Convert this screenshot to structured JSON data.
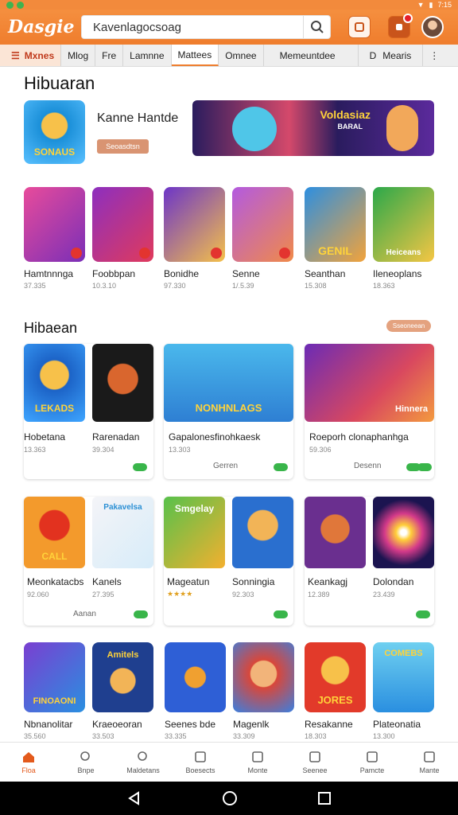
{
  "status": {
    "time": "7:15"
  },
  "header": {
    "logo": "Dasgie",
    "search_value": "Kavenlagocsoag"
  },
  "tabs": [
    "Mxnes",
    "Mlog",
    "Fre",
    "Lamnne",
    "Mattees",
    "Omnee",
    "Memeuntdee",
    "D",
    "Mearis"
  ],
  "featured": {
    "title": "Hibuaran",
    "app_icon_text": "SONAUS",
    "app_name": "Kanne Hantde",
    "button": "Seoasdtsn",
    "banner_title": "Voldasiaz",
    "banner_sub": "BARAL"
  },
  "row1": [
    {
      "name": "Hamtnnnga",
      "meta": "37.335",
      "color1": "#e84b9b",
      "color2": "#7a2fb7"
    },
    {
      "name": "Foobbpan",
      "meta": "10.3.10",
      "color1": "#8d2fbf",
      "color2": "#e03a5c"
    },
    {
      "name": "Bonidhe",
      "meta": "97.330",
      "color1": "#6c35c8",
      "color2": "#f4c04a"
    },
    {
      "name": "Senne",
      "meta": "1/.5.39",
      "color1": "#b35ae0",
      "color2": "#f08a49"
    },
    {
      "name": "Seanthan",
      "meta": "15.308",
      "color1": "#2d8fe0",
      "color2": "#f2a33b"
    },
    {
      "name": "Ileneoplans",
      "meta": "18.363",
      "color1": "#2ba84a",
      "color2": "#f5c644"
    }
  ],
  "row1_icon_text": {
    "4": "GENIL",
    "5": "Heiceans"
  },
  "section2": {
    "title": "Hibaean",
    "more": "Sseoneean"
  },
  "cards_row1": [
    {
      "name": "Hobetana",
      "meta": "13.363",
      "icon_text": "LEKADS"
    },
    {
      "name": "Rarenadan",
      "meta": "39.304"
    },
    {
      "name": "Gapalonesfinohkaesk",
      "meta": "13.303",
      "icon_text": "NONHNLAGS",
      "action": "Gerren"
    },
    {
      "name": "Roeporh clonaphanhga",
      "meta": "59.306",
      "icon_text": "Hinnera",
      "action": "Desenn"
    }
  ],
  "cards_row2": [
    {
      "name": "Meonkatacbs",
      "meta": "92.060",
      "icon_text": "CALL",
      "action": "Aanan"
    },
    {
      "name": "Kanels",
      "meta": "27.395",
      "icon_text": "Pakavelsa"
    },
    {
      "name": "Mageatun",
      "meta": "★★★★",
      "icon_text": "Smgelay"
    },
    {
      "name": "Sonningia",
      "meta": "92.303"
    },
    {
      "name": "Keankagj",
      "meta": "12.389"
    },
    {
      "name": "Dolondan",
      "meta": "23.439"
    }
  ],
  "cards_row3": [
    {
      "name": "Nbnanolitar",
      "meta": "35.560",
      "icon_text": "FINOAONI"
    },
    {
      "name": "Kraeoeoran",
      "meta": "33.503",
      "icon_text": "Amitels"
    },
    {
      "name": "Seenes bde",
      "meta": "33.335"
    },
    {
      "name": "Magenlk",
      "meta": "33.309"
    },
    {
      "name": "Resakanne",
      "meta": "18.303",
      "icon_text": "JORES"
    },
    {
      "name": "Plateonatia",
      "meta": "13.300",
      "icon_text": "COMEBS"
    }
  ],
  "nav": [
    {
      "label": "Floa",
      "active": true,
      "icon": "home-icon"
    },
    {
      "label": "Bnpe",
      "icon": "search-icon"
    },
    {
      "label": "Maldetans",
      "icon": "search-icon"
    },
    {
      "label": "Boesects",
      "icon": "shop-icon"
    },
    {
      "label": "Monte",
      "icon": "tag-icon"
    },
    {
      "label": "Seenee",
      "icon": "star-icon"
    },
    {
      "label": "Pamcte",
      "icon": "clock-icon"
    },
    {
      "label": "Mante",
      "icon": "bag-icon"
    }
  ],
  "colors": {
    "accent": "#ef7d2d",
    "download": "#39b54a"
  }
}
